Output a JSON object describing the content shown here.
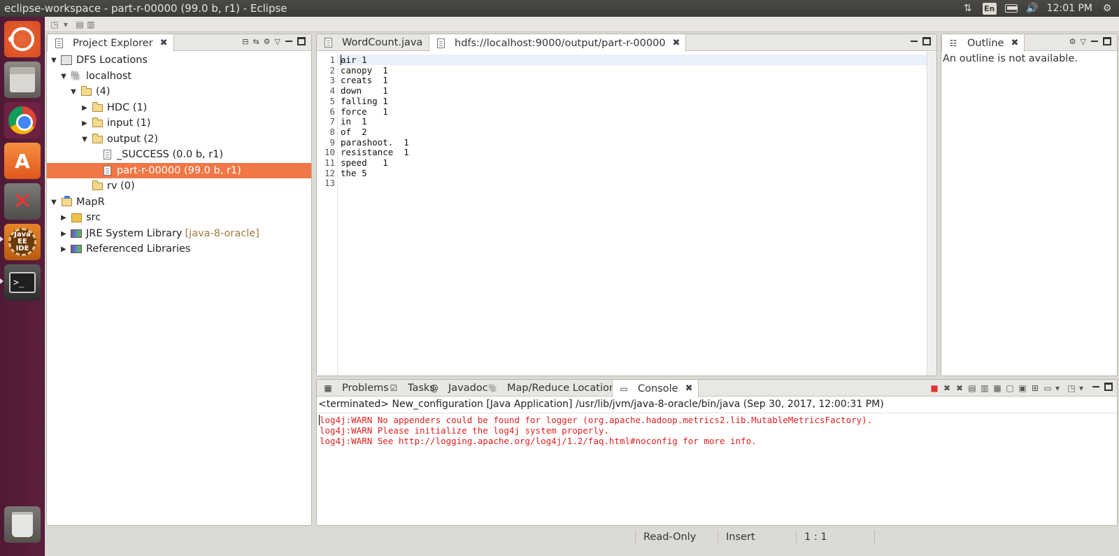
{
  "window": {
    "title": "eclipse-workspace - part-r-00000 (99.0 b, r1) - Eclipse"
  },
  "tray": {
    "language": "En",
    "time": "12:01 PM"
  },
  "launcher": {
    "items": [
      "ubuntu-dash",
      "files",
      "chrome",
      "software-center",
      "system-settings",
      "javaee-ide",
      "terminal",
      "trash"
    ],
    "javaee_label": "Java EE IDE"
  },
  "project_explorer": {
    "tab_label": "Project Explorer",
    "tree": [
      {
        "label": "DFS Locations",
        "level": 0,
        "expanded": true
      },
      {
        "label": "localhost",
        "level": 1,
        "expanded": true
      },
      {
        "label": "(4)",
        "level": 2,
        "expanded": true
      },
      {
        "label": "HDC (1)",
        "level": 3,
        "expanded": false
      },
      {
        "label": "input (1)",
        "level": 3,
        "expanded": false
      },
      {
        "label": "output (2)",
        "level": 3,
        "expanded": true
      },
      {
        "label": "_SUCCESS (0.0 b, r1)",
        "level": 4
      },
      {
        "label": "part-r-00000 (99.0 b, r1)",
        "level": 4,
        "selected": true
      },
      {
        "label": "rv (0)",
        "level": 3
      },
      {
        "label": "MapR",
        "level": 0,
        "expanded": true
      },
      {
        "label": "src",
        "level": 1,
        "expanded": false
      },
      {
        "label": "JRE System Library",
        "tag": "[java-8-oracle]",
        "level": 1,
        "expanded": false
      },
      {
        "label": "Referenced Libraries",
        "level": 1,
        "expanded": false
      }
    ]
  },
  "editor": {
    "tabs": [
      {
        "label": "WordCount.java",
        "active": false
      },
      {
        "label": "hdfs://localhost:9000/output/part-r-00000",
        "active": true
      }
    ],
    "lines": [
      "air 1",
      "canopy  1",
      "creats  1",
      "down    1",
      "falling 1",
      "force   1",
      "in  1",
      "of  2",
      "parashoot.  1",
      "resistance  1",
      "speed   1",
      "the 5",
      ""
    ],
    "line_numbers": [
      "1",
      "2",
      "3",
      "4",
      "5",
      "6",
      "7",
      "8",
      "9",
      "10",
      "11",
      "12",
      "13"
    ]
  },
  "outline": {
    "tab_label": "Outline",
    "message": "An outline is not available."
  },
  "bottom_panel": {
    "tabs": [
      {
        "label": "Problems"
      },
      {
        "label": "Tasks"
      },
      {
        "label": "Javadoc"
      },
      {
        "label": "Map/Reduce Locations"
      },
      {
        "label": "Console",
        "active": true
      }
    ],
    "console_status": "<terminated> New_configuration [Java Application] /usr/lib/jvm/java-8-oracle/bin/java (Sep 30, 2017, 12:00:31 PM)",
    "console_lines": [
      "log4j:WARN No appenders could be found for logger (org.apache.hadoop.metrics2.lib.MutableMetricsFactory).",
      "log4j:WARN Please initialize the log4j system properly.",
      "log4j:WARN See http://logging.apache.org/log4j/1.2/faq.html#noconfig for more info."
    ]
  },
  "statusbar": {
    "mode": "Read-Only",
    "insert": "Insert",
    "position": "1 : 1"
  },
  "colors": {
    "selection": "#f07746",
    "console_error": "#e02020",
    "launcher_bg": "#5c1f3e",
    "lib_tag": "#9e7a3d"
  }
}
